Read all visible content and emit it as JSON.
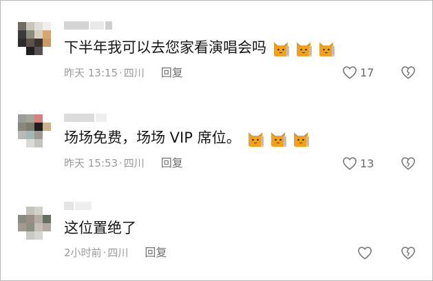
{
  "comments": [
    {
      "text": "下半年我可以去您家看演唱会吗",
      "time": "昨天 13:15",
      "location": "四川",
      "reply_label": "回复",
      "likes": "17",
      "emoji": "cat-face-emoji",
      "emoji_count": 3
    },
    {
      "text": "场场免费，场场 VIP 席位。",
      "time": "昨天 15:53",
      "location": "四川",
      "reply_label": "回复",
      "likes": "13",
      "emoji": "cat-face-emoji",
      "emoji_count": 3
    },
    {
      "text": "这位置绝了",
      "time": "2小时前",
      "location": "四川",
      "reply_label": "回复",
      "likes": "",
      "emoji": "",
      "emoji_count": 0
    }
  ],
  "separator": "·",
  "icons": {
    "like": "heart-outline-icon",
    "dislike": "broken-heart-outline-icon"
  },
  "colors": {
    "comment_text": "#161616",
    "meta_text": "#9a9a9a",
    "reply_text": "#707070",
    "icon_stroke": "#7a7a7a",
    "emoji_fill": "#f2a219"
  }
}
